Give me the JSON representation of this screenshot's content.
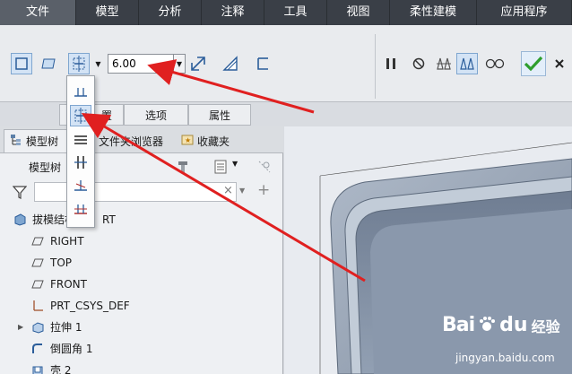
{
  "menubar": {
    "items": [
      "文件",
      "模型",
      "分析",
      "注释",
      "工具",
      "视图",
      "柔性建模",
      "应用程序"
    ]
  },
  "ribbon": {
    "depth_value": "6.00"
  },
  "ribbon_tabs": [
    "置",
    "选项",
    "属性"
  ],
  "navigator": {
    "tab_model_tree": "模型树",
    "tab_file_browser": "文件夹浏览器",
    "tab_favorites": "收藏夹",
    "tree_header": "模型树",
    "items": [
      {
        "label": "拔模结构",
        "suffix": "RT",
        "icon": "part-icon"
      },
      {
        "label": "RIGHT",
        "icon": "datum-plane-icon"
      },
      {
        "label": "TOP",
        "icon": "datum-plane-icon"
      },
      {
        "label": "FRONT",
        "icon": "datum-plane-icon"
      },
      {
        "label": "PRT_CSYS_DEF",
        "icon": "csys-icon"
      },
      {
        "label": "拉伸 1",
        "icon": "extrude-icon"
      },
      {
        "label": "倒圆角 1",
        "icon": "round-icon"
      },
      {
        "label": "壳 2",
        "icon": "shell-icon"
      }
    ]
  },
  "watermark": {
    "brand": "Bai",
    "brand_tail": "du",
    "sub": "经验",
    "url": "jingyan.baidu.com"
  },
  "colors": {
    "menubar": "#3a3f47",
    "accent_arrow": "#e02020",
    "confirm_green": "#2e9e2e",
    "part_body": "#7d8ea3"
  }
}
